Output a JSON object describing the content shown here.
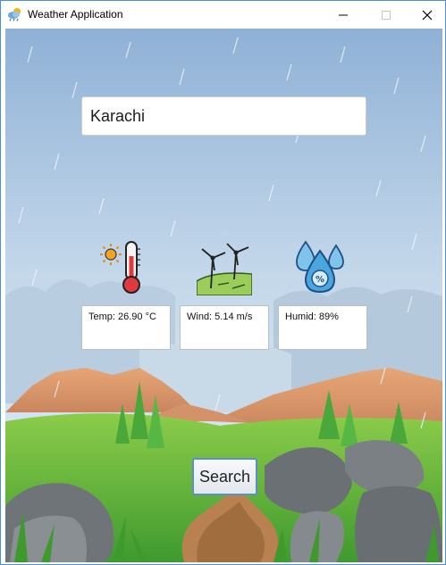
{
  "window": {
    "title": "Weather Application",
    "app_icon": "weather-cloud-icon",
    "controls": [
      "minimize-icon",
      "maximize-icon",
      "close-icon"
    ]
  },
  "search": {
    "city_value": "Karachi",
    "button_label": "Search"
  },
  "weather": {
    "temperature": {
      "icon": "thermometer-sun-icon",
      "label": "Temp: 26.90 °C"
    },
    "wind": {
      "icon": "wind-turbine-icon",
      "label": "Wind: 5.14 m/s"
    },
    "humidity": {
      "icon": "humidity-drops-icon",
      "label": "Humid: 89%"
    }
  },
  "colors": {
    "sky_top": "#8fb1d6",
    "sky_bottom": "#dce8f2",
    "mountain": "#d99a6c",
    "grass": "#5fb43a",
    "button_border": "#5a8fc8"
  }
}
